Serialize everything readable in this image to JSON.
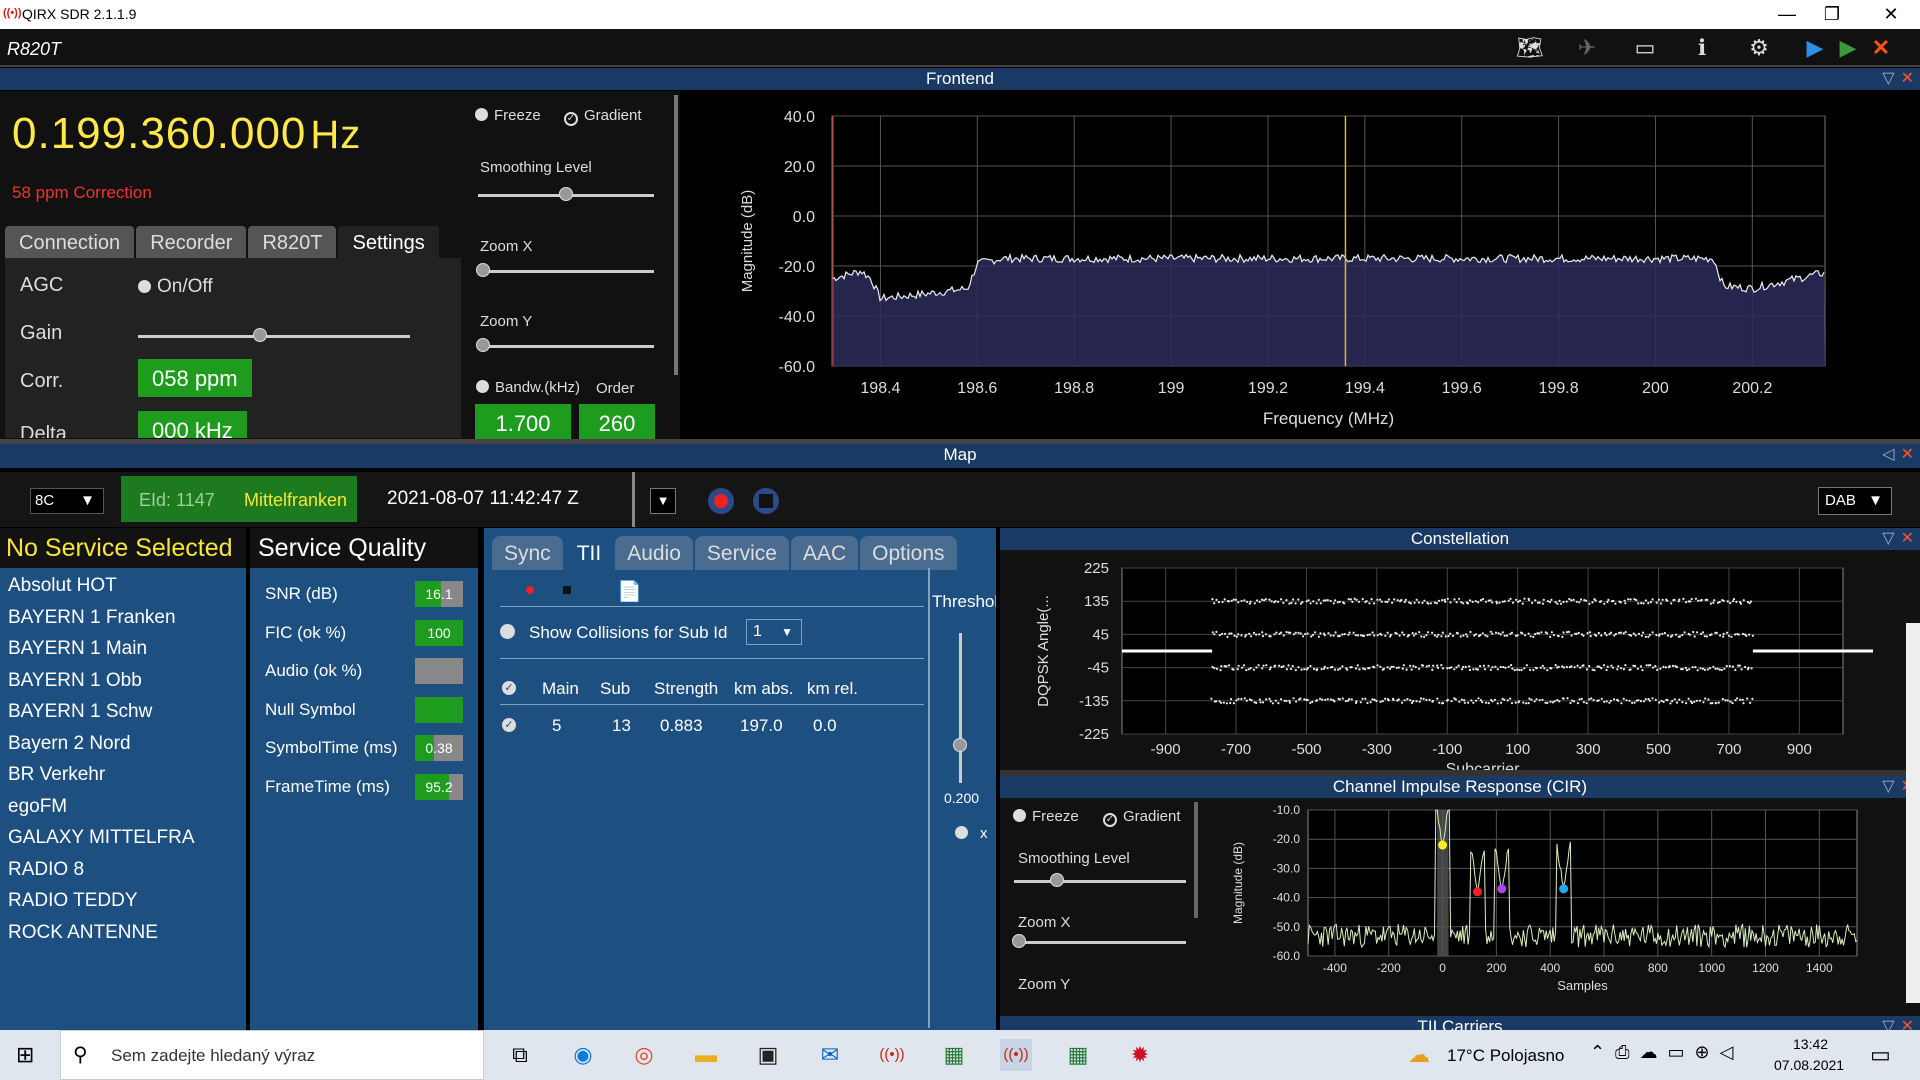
{
  "titlebar": {
    "title": "QIRX SDR 2.1.1.9",
    "minimize": "—",
    "restore": "❐",
    "close": "✕"
  },
  "toolbar": {
    "device": "R820T",
    "icons": [
      "map-icon",
      "satellite-icon",
      "window-icon",
      "info-icon",
      "gear-icon",
      "play-blue-icon",
      "play-green-icon",
      "close-icon"
    ]
  },
  "frontend": {
    "header": "Frontend",
    "frequency": "0.199.360.000",
    "frequency_unit": "Hz",
    "correction": "58 ppm Correction",
    "tabs": [
      "Connection",
      "Recorder",
      "R820T",
      "Settings"
    ],
    "active_tab": "Settings",
    "agc_label": "AGC",
    "agc_toggle": "On/Off",
    "gain_label": "Gain",
    "gain_level": 0.45,
    "corr_label": "Corr.",
    "corr_value": "058 ppm",
    "delta_label": "Delta",
    "delta_value": "000 kHz",
    "freeze": "Freeze",
    "gradient": "Gradient",
    "smoothing": "Smoothing Level",
    "smoothing_level": 0.5,
    "zoom_x": "Zoom X",
    "zoom_y": "Zoom Y",
    "bandw": "Bandw.(kHz)",
    "order": "Order",
    "bandw_value": "1.700",
    "order_value": "260"
  },
  "spectrum": {
    "chart_data": {
      "type": "line",
      "xlabel": "Frequency (MHz)",
      "ylabel": "Magnitude (dB)",
      "xlim": [
        198.3,
        200.35
      ],
      "ylim": [
        -60,
        40
      ],
      "xticks": [
        "198.4",
        "198.6",
        "198.8",
        "199",
        "199.2",
        "199.4",
        "199.6",
        "199.8",
        "200",
        "200.2"
      ],
      "yticks": [
        "40.0",
        "20.0",
        "0.0",
        "-20.0",
        "-40.0",
        "-60.0"
      ],
      "marker_mhz": 199.36,
      "series": [
        {
          "x": [
            198.3,
            198.36,
            198.38,
            198.4,
            198.5,
            198.58,
            198.6,
            198.65,
            199.0,
            199.5,
            200.0,
            200.12,
            200.14,
            200.2,
            200.34
          ],
          "values": [
            -25,
            -22,
            -25,
            -33,
            -31,
            -29,
            -19,
            -17,
            -17,
            -17,
            -17,
            -17,
            -28,
            -29,
            -23
          ]
        }
      ]
    }
  },
  "map": {
    "header": "Map"
  },
  "controls": {
    "channel": "8C",
    "eid": "EId: 1147",
    "ensemble": "Mittelfranken",
    "datetime": "2021-08-07  11:42:47 Z",
    "mode": "DAB"
  },
  "services": {
    "header": "No Service Selected",
    "items": [
      "Absolut HOT",
      "BAYERN 1 Franken",
      "BAYERN 1 Main",
      "BAYERN 1 Obb",
      "BAYERN 1 Schw",
      "Bayern 2 Nord",
      "BR Verkehr",
      "egoFM",
      "GALAXY MITTELFRA",
      "RADIO 8",
      "RADIO TEDDY",
      "ROCK ANTENNE"
    ]
  },
  "quality": {
    "header": "Service Quality",
    "rows": [
      {
        "label": "SNR (dB)",
        "value": "16.1",
        "fill": 0.55
      },
      {
        "label": "FIC (ok %)",
        "value": "100",
        "fill": 1.0
      },
      {
        "label": "Audio (ok %)",
        "value": "",
        "fill": 0.0
      },
      {
        "label": "Null Symbol",
        "value": "",
        "fill": 1.0
      },
      {
        "label": "SymbolTime (ms)",
        "value": "0.38",
        "fill": 0.4
      },
      {
        "label": "FrameTime (ms)",
        "value": "95.2",
        "fill": 0.7
      }
    ]
  },
  "tii": {
    "tabs": [
      "Sync",
      "TII",
      "Audio",
      "Service",
      "AAC",
      "Options"
    ],
    "active_tab": "TII",
    "threshold": "Threshol",
    "threshold_value": "0.200",
    "show_collisions": "Show Collisions for Sub Id",
    "sub_id": "1",
    "columns": [
      "Main",
      "Sub",
      "Strength",
      "km abs.",
      "km rel."
    ],
    "rows": [
      [
        "5",
        "13",
        "0.883",
        "197.0",
        "0.0"
      ]
    ],
    "x_label": "x"
  },
  "constellation": {
    "header": "Constellation",
    "chart_data": {
      "type": "scatter",
      "xlabel": "Subcarrier",
      "ylabel": "DQPSK  Angle(...",
      "xticks": [
        "-900",
        "-700",
        "-500",
        "-300",
        "-100",
        "100",
        "300",
        "500",
        "700",
        "900"
      ],
      "yticks": [
        "225",
        "135",
        "45",
        "-45",
        "-135",
        "-225"
      ],
      "xlim": [
        -1024,
        1024
      ],
      "ylim": [
        -225,
        225
      ],
      "levels": [
        135,
        45,
        -45,
        -135
      ],
      "carrier_range": [
        -768,
        768
      ]
    }
  },
  "cir": {
    "header": "Channel Impulse Response (CIR)",
    "freeze": "Freeze",
    "gradient": "Gradient",
    "smoothing": "Smoothing Level",
    "smoothing_level": 0.25,
    "zoom_x": "Zoom X",
    "zoom_y": "Zoom Y",
    "chart_data": {
      "type": "line",
      "xlabel": "Samples",
      "ylabel": "Magnitude (dB)",
      "xticks": [
        "-400",
        "-200",
        "0",
        "200",
        "400",
        "600",
        "800",
        "1000",
        "1200",
        "1400"
      ],
      "yticks": [
        "-10.0",
        "-20.0",
        "-30.0",
        "-40.0",
        "-50.0",
        "-60.0"
      ],
      "xlim": [
        -500,
        1540
      ],
      "ylim": [
        -60,
        -10
      ],
      "peaks": [
        {
          "x": 0,
          "y": -22,
          "color": "#ffee22"
        },
        {
          "x": 130,
          "y": -38,
          "color": "#ee2222"
        },
        {
          "x": 220,
          "y": -37,
          "color": "#aa44ee"
        },
        {
          "x": 450,
          "y": -37,
          "color": "#22aaee"
        }
      ]
    }
  },
  "tii_carriers": {
    "header": "TII Carriers"
  },
  "taskbar": {
    "search": "Sem zadejte hledaný výraz",
    "weather": "17°C  Polojasno",
    "time": "13:42",
    "date": "07.08.2021"
  }
}
